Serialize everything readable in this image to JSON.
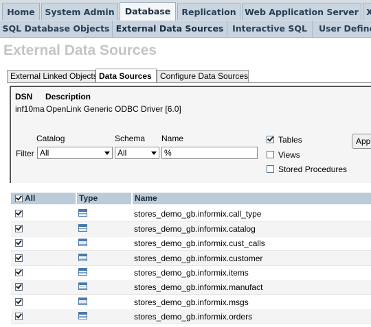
{
  "nav": {
    "main_tabs": [
      "Home",
      "System Admin",
      "Database",
      "Replication",
      "Web Application Server",
      "X"
    ],
    "sub_tabs": [
      "SQL Database Objects",
      "External Data Sources",
      "Interactive SQL",
      "User Define"
    ]
  },
  "page_title": "External Data Sources",
  "subtabs": [
    "External Linked Objects",
    "Data Sources",
    "Configure Data Sources"
  ],
  "panel": {
    "dsn_label": "DSN",
    "description_label": "Description",
    "dsn_value": "inf10ma",
    "description_value": "OpenLink Generic ODBC Driver [6.0]",
    "catalog_label": "Catalog",
    "schema_label": "Schema",
    "name_label": "Name",
    "filter_label": "Filter",
    "catalog_value": "All",
    "schema_value": "All",
    "name_value": "%",
    "tables_label": "Tables",
    "views_label": "Views",
    "procs_label": "Stored Procedures",
    "apply_label": "Apply"
  },
  "table": {
    "headers": {
      "all": "All",
      "type": "Type",
      "name": "Name"
    },
    "rows": [
      "stores_demo_gb.informix.call_type",
      "stores_demo_gb.informix.catalog",
      "stores_demo_gb.informix.cust_calls",
      "stores_demo_gb.informix.customer",
      "stores_demo_gb.informix.items",
      "stores_demo_gb.informix.manufact",
      "stores_demo_gb.informix.msgs",
      "stores_demo_gb.informix.orders"
    ]
  }
}
